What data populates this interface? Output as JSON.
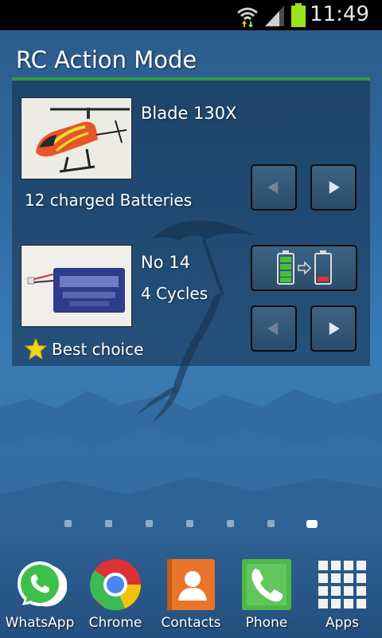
{
  "status_bar": {
    "time": "11:49",
    "icons": [
      "wifi-icon",
      "signal-icon",
      "battery-icon"
    ],
    "battery_color": "#9be21f"
  },
  "widget": {
    "title": "RC Action Mode",
    "accent_color": "#2f9a45",
    "model": {
      "name": "Blade 130X",
      "charged": "12 charged Batteries",
      "image": "helicopter-photo"
    },
    "battery": {
      "number": "No 14",
      "cycles": "4 Cycles",
      "best_label": "Best choice",
      "image": "lipo-battery-photo"
    },
    "swap_icon": "battery-swap-icon"
  },
  "home": {
    "page_count": 7,
    "active_page": 7
  },
  "dock": [
    {
      "label": "WhatsApp",
      "icon": "whatsapp-icon"
    },
    {
      "label": "Chrome",
      "icon": "chrome-icon"
    },
    {
      "label": "Contacts",
      "icon": "contacts-icon"
    },
    {
      "label": "Phone",
      "icon": "phone-icon"
    },
    {
      "label": "Apps",
      "icon": "apps-grid-icon"
    }
  ]
}
